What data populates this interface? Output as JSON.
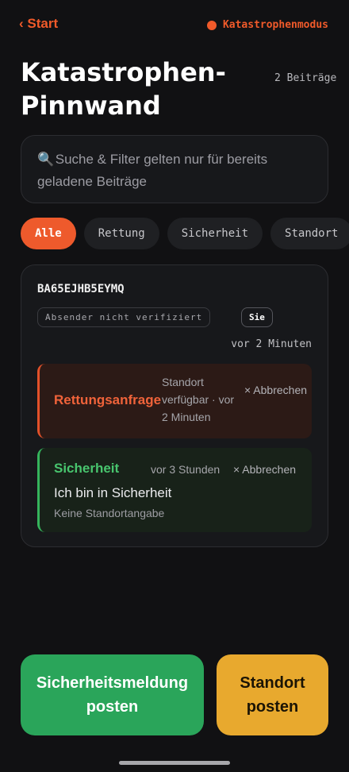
{
  "header": {
    "back_label": "‹ Start",
    "mode_label": "Katastrophenmodus",
    "accent_color": "#f05a2a"
  },
  "page": {
    "title": "Katastrophen-Pinnwand",
    "post_count": "2 Beiträge"
  },
  "search": {
    "icon": "magnifier-icon",
    "icon_glyph": "🔍",
    "text": "Suche & Filter gelten nur für bereits geladene Beiträge"
  },
  "filters": {
    "chips": [
      "Alle",
      "Rettung",
      "Sicherheit",
      "Standort"
    ],
    "active": "Alle"
  },
  "post": {
    "sender_id": "BA65EJHB5EYMQ",
    "unverified_label": "Absender nicht verifiziert",
    "you_label": "Sie",
    "time": "vor 2 Minuten",
    "messages": [
      {
        "type": "Rettungsanfrage",
        "meta": "Standort verfügbar · vor 2 Minuten",
        "cancel": "× Abbrechen",
        "color": "#f0633a"
      },
      {
        "type": "Sicherheit",
        "meta": "vor 3 Stunden",
        "cancel": "× Abbrechen",
        "body": "Ich bin in Sicherheit",
        "sub": "Keine Standortangabe",
        "color": "#48c56e"
      }
    ]
  },
  "actions": {
    "safety_button": "Sicherheitsmeldung posten",
    "location_button": "Standort posten",
    "safety_color": "#2aa55a",
    "location_color": "#e8a92e"
  }
}
